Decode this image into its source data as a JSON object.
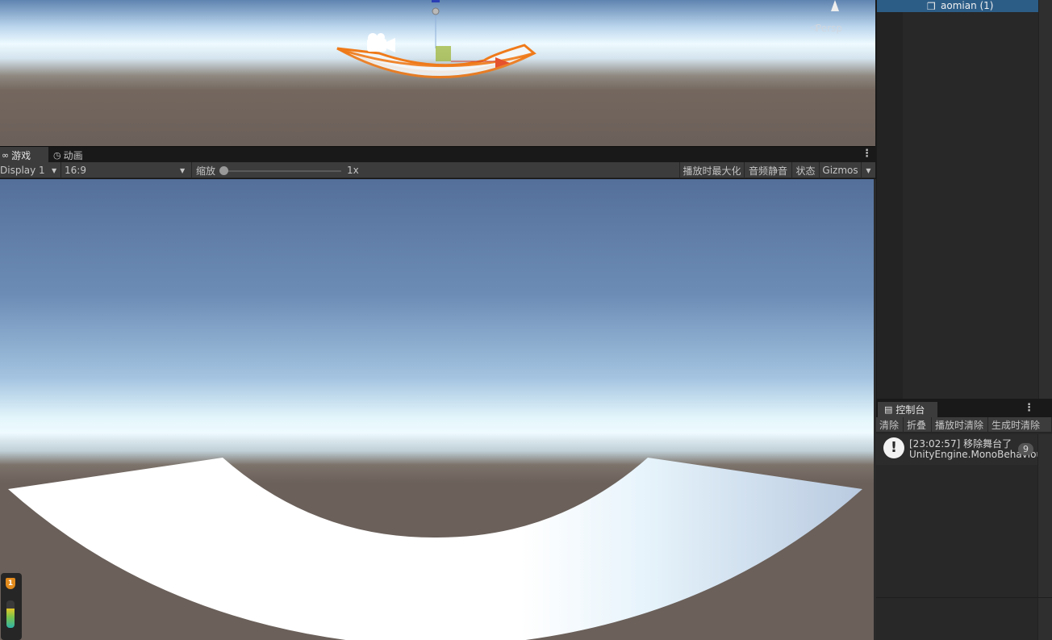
{
  "scene": {
    "persp_label": "Persp"
  },
  "game_tabs": [
    {
      "label": "游戏",
      "icon": "gamepad-icon"
    },
    {
      "label": "动画",
      "icon": "clock-icon"
    }
  ],
  "game_toolbar": {
    "display": "Display 1",
    "aspect": "16:9",
    "scale_label": "缩放",
    "scale_value": "1x",
    "maximize_on_play": "播放时最大化",
    "mute_audio": "音频静音",
    "stats": "状态",
    "gizmos": "Gizmos"
  },
  "hierarchy": {
    "selected_item": "aomian (1)"
  },
  "console": {
    "tab_label": "控制台",
    "buttons": [
      "清除",
      "折叠",
      "播放时清除",
      "生成时清除"
    ],
    "entry": {
      "line1": "[23:02:57] 移除舞台了",
      "line2": "UnityEngine.MonoBehaviour",
      "count": "9"
    }
  },
  "stats_widget": {
    "badge": "1"
  }
}
